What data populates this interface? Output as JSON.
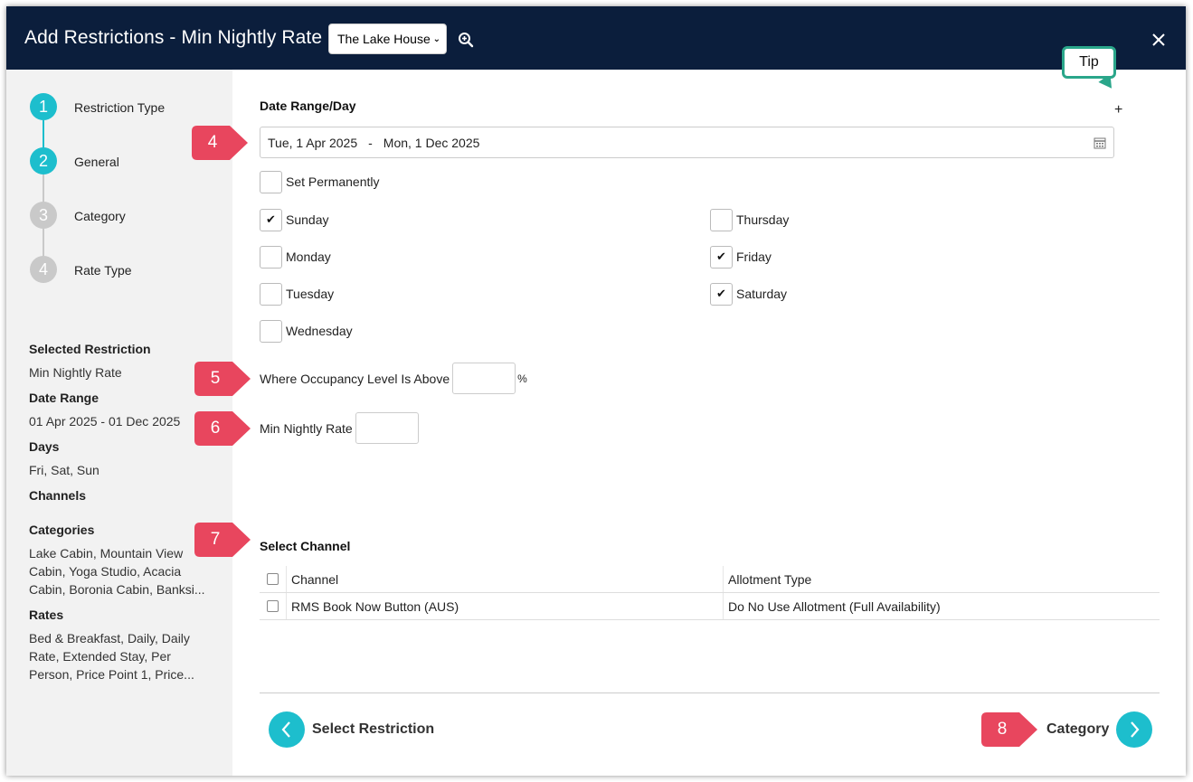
{
  "header": {
    "title": "Add Restrictions - Min Nightly Rate",
    "property_selected": "The Lake House"
  },
  "steps": [
    {
      "number": "1",
      "label": "Restriction Type",
      "state": "complete"
    },
    {
      "number": "2",
      "label": "General",
      "state": "active"
    },
    {
      "number": "3",
      "label": "Category",
      "state": "pending"
    },
    {
      "number": "4",
      "label": "Rate Type",
      "state": "pending"
    }
  ],
  "summary": {
    "selected_restriction_h": "Selected Restriction",
    "selected_restriction_v": "Min Nightly Rate",
    "date_range_h": "Date Range",
    "date_range_v": "01 Apr 2025 - 01 Dec 2025",
    "days_h": "Days",
    "days_v": "Fri, Sat, Sun",
    "channels_h": "Channels",
    "categories_h": "Categories",
    "categories_v": "Lake Cabin, Mountain View Cabin, Yoga Studio, Acacia Cabin, Boronia Cabin, Banksi...",
    "rates_h": "Rates",
    "rates_v": "Bed & Breakfast, Daily, Daily Rate, Extended Stay, Per Person, Price Point 1, Price..."
  },
  "form": {
    "tip_label": "Tip",
    "date_range_label": "Date Range/Day",
    "date_start": "Tue, 1 Apr 2025",
    "date_sep": "-",
    "date_end": "Mon, 1 Dec 2025",
    "set_permanently": "Set Permanently",
    "days": [
      {
        "label": "Sunday",
        "checked": true
      },
      {
        "label": "Monday",
        "checked": false
      },
      {
        "label": "Tuesday",
        "checked": false
      },
      {
        "label": "Wednesday",
        "checked": false
      },
      {
        "label": "Thursday",
        "checked": false
      },
      {
        "label": "Friday",
        "checked": true
      },
      {
        "label": "Saturday",
        "checked": true
      }
    ],
    "occupancy_label": "Where Occupancy Level Is Above",
    "occupancy_unit": "%",
    "min_rate_label": "Min Nightly Rate",
    "select_channel_label": "Select Channel"
  },
  "channel_table": {
    "headers": [
      "Channel",
      "Allotment Type"
    ],
    "rows": [
      {
        "channel": "RMS Book Now Button (AUS)",
        "allotment": "Do No Use Allotment (Full Availability)"
      }
    ]
  },
  "footer": {
    "back_label": "Select Restriction",
    "next_label": "Category"
  },
  "callouts": [
    "4",
    "5",
    "6",
    "7",
    "8"
  ],
  "colors": {
    "header_bg": "#0b1e3c",
    "accent": "#1dbecd",
    "callout": "#e8465e",
    "tip_border": "#2aa68a"
  }
}
